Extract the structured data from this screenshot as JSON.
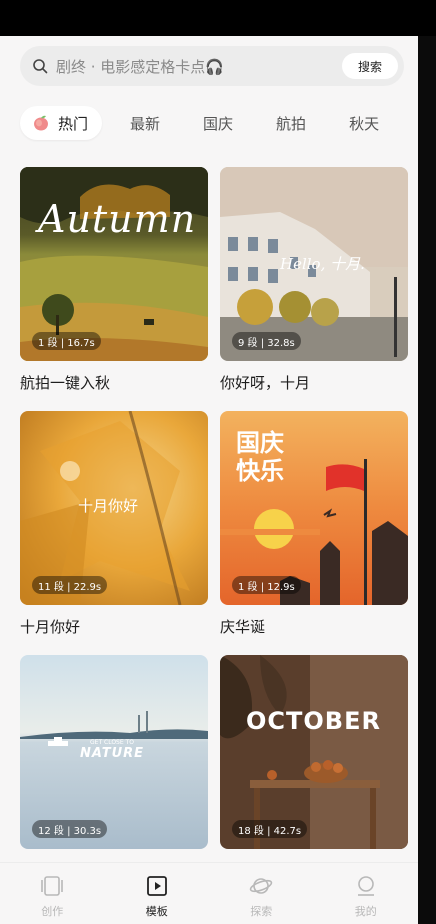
{
  "search": {
    "text": "剧终 · 电影感定格卡点🎧",
    "button_label": "搜索"
  },
  "tabs": [
    {
      "label": "热门",
      "active": true
    },
    {
      "label": "最新"
    },
    {
      "label": "国庆"
    },
    {
      "label": "航拍"
    },
    {
      "label": "秋天"
    }
  ],
  "templates": [
    {
      "title": "航拍一键入秋",
      "badge": "1 段 | 16.7s",
      "overlay": "Autumn"
    },
    {
      "title": "你好呀，十月",
      "badge": "9 段 | 32.8s",
      "overlay": "Hello, 十月."
    },
    {
      "title": "十月你好",
      "badge": "11 段 | 22.9s",
      "overlay": "十月你好"
    },
    {
      "title": "庆华诞",
      "badge": "1 段 | 12.9s",
      "overlay": "国庆快乐"
    },
    {
      "title": "",
      "badge": "12 段 | 30.3s",
      "overlay": "NATURE",
      "overlay_small": "GET CLOSE TO"
    },
    {
      "title": "",
      "badge": "18 段 | 42.7s",
      "overlay": "OCTOBER"
    }
  ],
  "nav": [
    {
      "label": "创作",
      "icon": "create-icon"
    },
    {
      "label": "模板",
      "icon": "template-icon",
      "active": true
    },
    {
      "label": "探索",
      "icon": "planet-icon"
    },
    {
      "label": "我的",
      "icon": "profile-icon"
    }
  ],
  "colors": {
    "background": "#f7f6f6",
    "search_bg": "#ececec",
    "text_primary": "#1e1e1e",
    "nav_inactive": "#b8b8b8"
  }
}
